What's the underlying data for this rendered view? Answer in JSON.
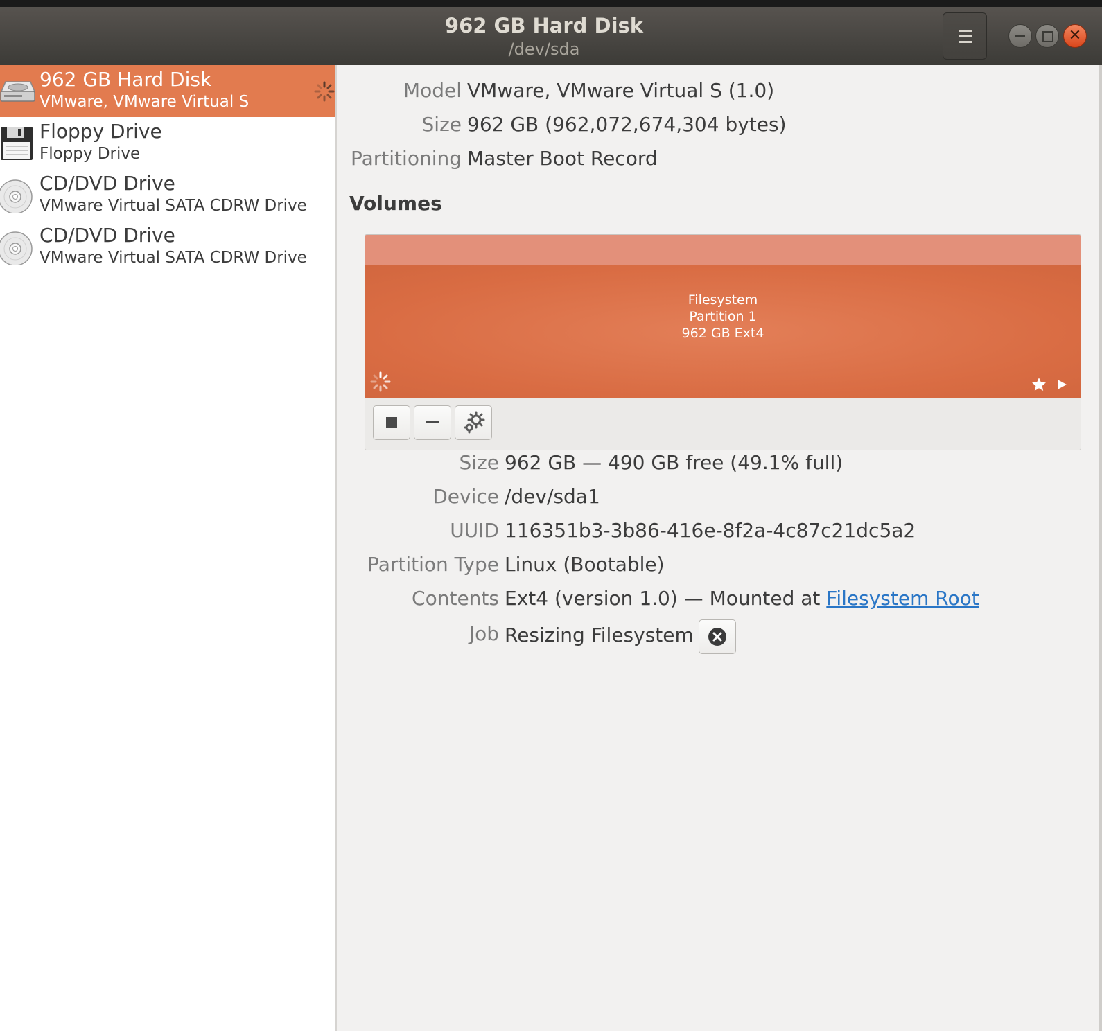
{
  "window": {
    "title": "962 GB Hard Disk",
    "subtitle": "/dev/sda"
  },
  "drives": [
    {
      "name": "962 GB Hard Disk",
      "sub": "VMware, VMware Virtual S",
      "icon": "hard-disk-icon",
      "selected": true,
      "busy": true
    },
    {
      "name": "Floppy Drive",
      "sub": "Floppy Drive",
      "icon": "floppy-icon"
    },
    {
      "name": "CD/DVD Drive",
      "sub": "VMware Virtual SATA CDRW Drive",
      "icon": "optical-disc-icon"
    },
    {
      "name": "CD/DVD Drive",
      "sub": "VMware Virtual SATA CDRW Drive",
      "icon": "optical-disc-icon"
    }
  ],
  "disk": {
    "model_label": "Model",
    "model": "VMware, VMware Virtual S (1.0)",
    "size_label": "Size",
    "size": "962 GB (962,072,674,304 bytes)",
    "partitioning_label": "Partitioning",
    "partitioning": "Master Boot Record"
  },
  "volumes": {
    "heading": "Volumes",
    "partition": {
      "line1": "Filesystem",
      "line2": "Partition 1",
      "line3": "962 GB Ext4"
    }
  },
  "volume_details": {
    "size_label": "Size",
    "size": "962 GB — 490 GB free (49.1% full)",
    "device_label": "Device",
    "device": "/dev/sda1",
    "uuid_label": "UUID",
    "uuid": "116351b3-3b86-416e-8f2a-4c87c21dc5a2",
    "ptype_label": "Partition Type",
    "ptype": "Linux (Bootable)",
    "contents_label": "Contents",
    "contents_prefix": "Ext4 (version 1.0) — Mounted at ",
    "contents_link": "Filesystem Root",
    "job_label": "Job",
    "job": "Resizing Filesystem"
  },
  "colors": {
    "accent": "#e27b4f",
    "partition": "#d96c43",
    "link": "#2a76c6"
  }
}
